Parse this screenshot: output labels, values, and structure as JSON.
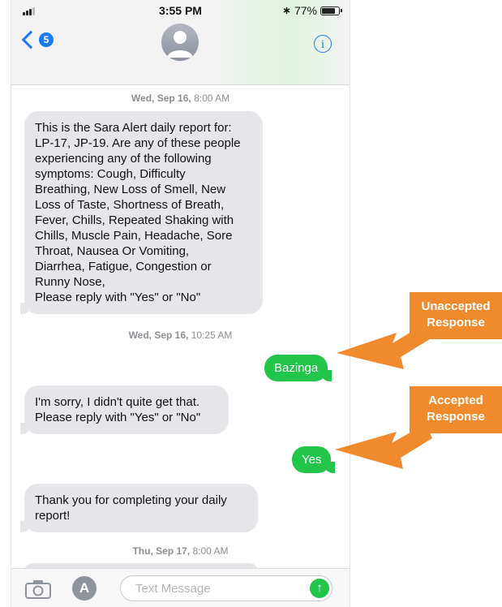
{
  "status_bar": {
    "time": "3:55 PM",
    "battery": "77%",
    "bluetooth_icon": "bluetooth-icon"
  },
  "nav": {
    "back_badge": "5",
    "info_icon": "info-icon",
    "contact_avatar_icon": "person-silhouette-icon"
  },
  "messages": [
    {
      "type": "timestamp",
      "day": "Wed, Sep 16,",
      "time": "8:00 AM"
    },
    {
      "type": "incoming",
      "text": "This is the Sara Alert daily report for:\nLP-17, JP-19. Are any of these people\nexperiencing any of the following\nsymptoms: Cough, Difficulty\nBreathing, New Loss of Smell, New\nLoss of Taste, Shortness of Breath,\nFever, Chills, Repeated Shaking with\nChills, Muscle Pain, Headache, Sore\nThroat, Nausea Or Vomiting,\nDiarrhea, Fatigue, Congestion or\nRunny Nose,\nPlease reply with \"Yes\" or \"No\""
    },
    {
      "type": "timestamp",
      "day": "Wed, Sep 16,",
      "time": "10:25 AM"
    },
    {
      "type": "outgoing",
      "text": "Bazinga"
    },
    {
      "type": "incoming",
      "text": "I'm sorry, I didn't quite get that.\nPlease reply with \"Yes\" or \"No\""
    },
    {
      "type": "outgoing",
      "text": "Yes"
    },
    {
      "type": "incoming",
      "text": "Thank you for completing your daily\nreport!"
    },
    {
      "type": "timestamp",
      "day": "Thu, Sep 17,",
      "time": "8:00 AM"
    }
  ],
  "input_bar": {
    "placeholder": "Text Message",
    "camera_icon": "camera-icon",
    "apps_icon": "app-store-icon",
    "send_icon": "send-arrow-up-icon"
  },
  "annotations": [
    {
      "line1": "Unaccepted",
      "line2": "Response"
    },
    {
      "line1": "Accepted",
      "line2": "Response"
    }
  ],
  "colors": {
    "ios_blue": "#1a7cf5",
    "sent_green": "#21c54a",
    "received_gray": "#e5e5ea",
    "callout_orange": "#f08a2c"
  }
}
